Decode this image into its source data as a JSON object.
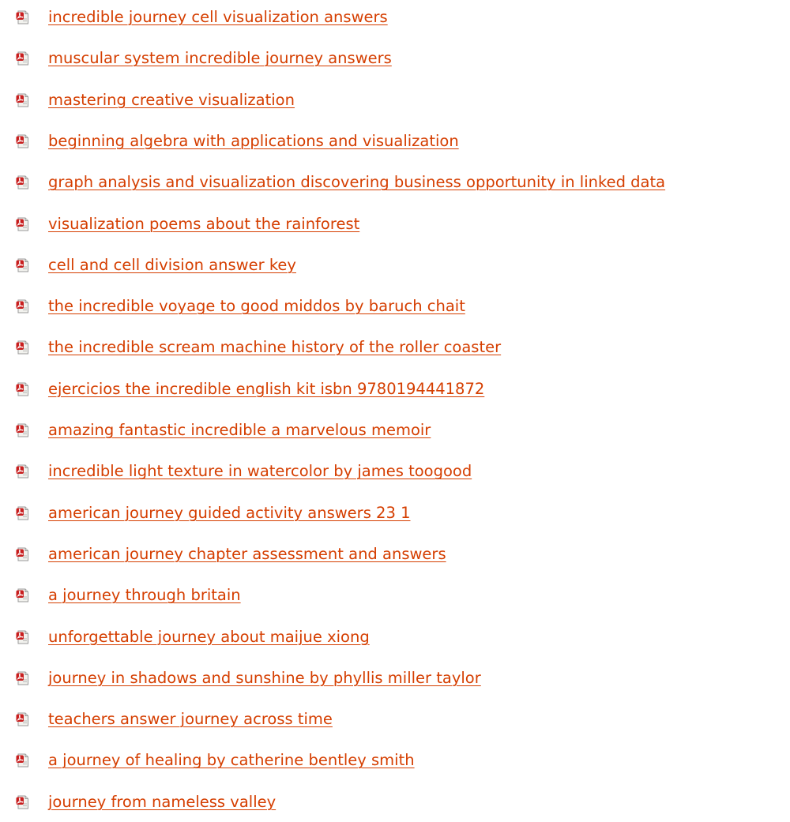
{
  "colors": {
    "link": "#d53e00",
    "icon_red": "#c81e1e",
    "icon_page": "#f2f2ee"
  },
  "icon": "pdf-file-icon",
  "documents": [
    {
      "label": "incredible journey cell visualization answers"
    },
    {
      "label": "muscular system incredible journey answers"
    },
    {
      "label": "mastering creative visualization"
    },
    {
      "label": "beginning algebra with applications and visualization"
    },
    {
      "label": "graph analysis and visualization discovering business opportunity in linked data"
    },
    {
      "label": "visualization poems about the rainforest"
    },
    {
      "label": "cell and cell division answer key"
    },
    {
      "label": "the incredible voyage to good middos by baruch chait"
    },
    {
      "label": "the incredible scream machine history of the roller coaster"
    },
    {
      "label": "ejercicios the incredible english kit isbn 9780194441872"
    },
    {
      "label": "amazing fantastic incredible a marvelous memoir"
    },
    {
      "label": "incredible light texture in watercolor by james toogood"
    },
    {
      "label": "american journey guided activity answers 23 1"
    },
    {
      "label": "american journey chapter assessment and answers"
    },
    {
      "label": "a journey through britain"
    },
    {
      "label": "unforgettable journey about maijue xiong"
    },
    {
      "label": "journey in shadows and sunshine by phyllis miller taylor"
    },
    {
      "label": "teachers answer journey across time"
    },
    {
      "label": "a journey of healing by catherine bentley smith"
    },
    {
      "label": "journey from nameless valley"
    }
  ]
}
